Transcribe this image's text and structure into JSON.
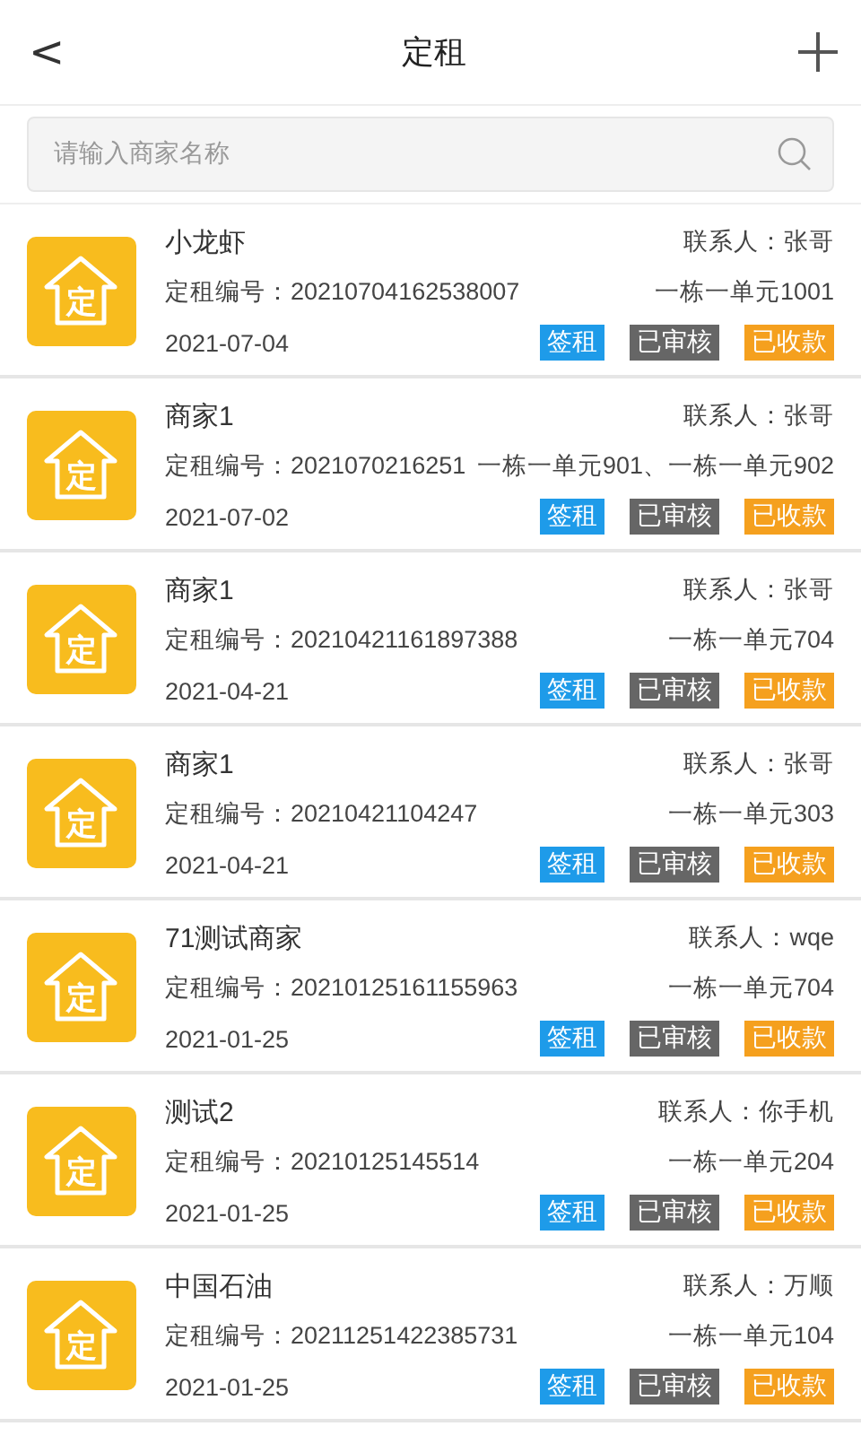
{
  "header": {
    "back": "<",
    "title": "定租"
  },
  "search": {
    "placeholder": "请输入商家名称"
  },
  "items": [
    {
      "badge": "定",
      "name": "小龙虾",
      "contact": "联系人：张哥",
      "code": "定租编号：20210704162538007",
      "unit": "一栋一单元1001",
      "date": "2021-07-04",
      "tags": [
        {
          "label": "签租",
          "color": "#1e9be9"
        },
        {
          "label": "已审核",
          "color": "#666666"
        },
        {
          "label": "已收款",
          "color": "#f5a01e"
        }
      ]
    },
    {
      "badge": "定",
      "name": "商家1",
      "contact": "联系人：张哥",
      "code": "定租编号：2021070216251",
      "unit": "一栋一单元901、一栋一单元902",
      "date": "2021-07-02",
      "tags": [
        {
          "label": "签租",
          "color": "#1e9be9"
        },
        {
          "label": "已审核",
          "color": "#666666"
        },
        {
          "label": "已收款",
          "color": "#f5a01e"
        }
      ]
    },
    {
      "badge": "定",
      "name": "商家1",
      "contact": "联系人：张哥",
      "code": "定租编号：20210421161897388",
      "unit": "一栋一单元704",
      "date": "2021-04-21",
      "tags": [
        {
          "label": "签租",
          "color": "#1e9be9"
        },
        {
          "label": "已审核",
          "color": "#666666"
        },
        {
          "label": "已收款",
          "color": "#f5a01e"
        }
      ]
    },
    {
      "badge": "定",
      "name": "商家1",
      "contact": "联系人：张哥",
      "code": "定租编号：20210421104247",
      "unit": "一栋一单元303",
      "date": "2021-04-21",
      "tags": [
        {
          "label": "签租",
          "color": "#1e9be9"
        },
        {
          "label": "已审核",
          "color": "#666666"
        },
        {
          "label": "已收款",
          "color": "#f5a01e"
        }
      ]
    },
    {
      "badge": "定",
      "name": "71测试商家",
      "contact": "联系人：wqe",
      "code": "定租编号：20210125161155963",
      "unit": "一栋一单元704",
      "date": "2021-01-25",
      "tags": [
        {
          "label": "签租",
          "color": "#1e9be9"
        },
        {
          "label": "已审核",
          "color": "#666666"
        },
        {
          "label": "已收款",
          "color": "#f5a01e"
        }
      ]
    },
    {
      "badge": "定",
      "name": "测试2",
      "contact": "联系人：你手机",
      "code": "定租编号：20210125145514",
      "unit": "一栋一单元204",
      "date": "2021-01-25",
      "tags": [
        {
          "label": "签租",
          "color": "#1e9be9"
        },
        {
          "label": "已审核",
          "color": "#666666"
        },
        {
          "label": "已收款",
          "color": "#f5a01e"
        }
      ]
    },
    {
      "badge": "定",
      "name": "中国石油",
      "contact": "联系人：万顺",
      "code": "定租编号：20211251422385731",
      "unit": "一栋一单元104",
      "date": "2021-01-25",
      "tags": [
        {
          "label": "签租",
          "color": "#1e9be9"
        },
        {
          "label": "已审核",
          "color": "#666666"
        },
        {
          "label": "已收款",
          "color": "#f5a01e"
        }
      ]
    }
  ]
}
